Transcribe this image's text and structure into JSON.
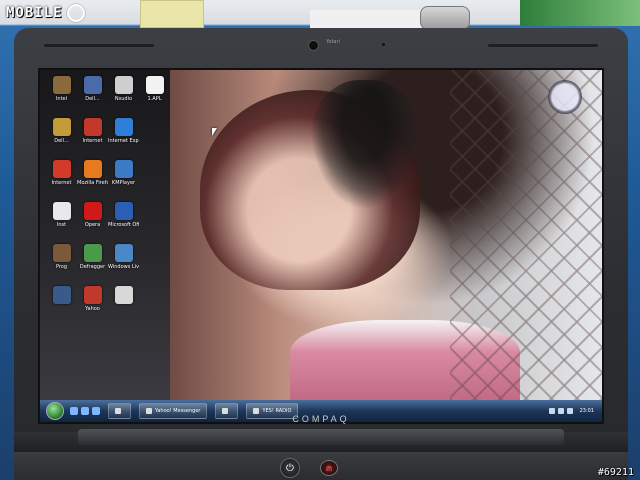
{
  "logo": {
    "text": "MOBILE"
  },
  "watermark": "#69211",
  "laptop": {
    "brand": "COMPAQ",
    "webcam_brand": "Yotari"
  },
  "desktop": {
    "icons": [
      {
        "label": "Intel",
        "icon": "folder-icon",
        "color": "#8a6a3a"
      },
      {
        "label": "Dell...",
        "icon": "app-icon",
        "color": "#4a6aaa"
      },
      {
        "label": "Nsudio",
        "icon": "folder-icon",
        "color": "#cfcfcf"
      },
      {
        "label": "1.APL",
        "icon": "file-icon",
        "color": "#f2f2f2"
      },
      {
        "label": "Dell...",
        "icon": "folder-icon",
        "color": "#c49a3a"
      },
      {
        "label": "Internet",
        "icon": "app-icon",
        "color": "#c0392b"
      },
      {
        "label": "Internet Explorer",
        "icon": "ie-icon",
        "color": "#2f7fd8"
      },
      {
        "label": "",
        "icon": "",
        "color": ""
      },
      {
        "label": "Internet",
        "icon": "app-icon",
        "color": "#d23a2a"
      },
      {
        "label": "Mozilla Firefox",
        "icon": "firefox-icon",
        "color": "#e57a1f"
      },
      {
        "label": "KMPlayer",
        "icon": "player-icon",
        "color": "#3a7ac7"
      },
      {
        "label": "",
        "icon": "",
        "color": ""
      },
      {
        "label": "Inst",
        "icon": "file-icon",
        "color": "#e8e8e8"
      },
      {
        "label": "Opera",
        "icon": "opera-icon",
        "color": "#d01a1a"
      },
      {
        "label": "Microsoft Office Word",
        "icon": "word-icon",
        "color": "#2b5fb4"
      },
      {
        "label": "",
        "icon": "",
        "color": ""
      },
      {
        "label": "Prog",
        "icon": "app-icon",
        "color": "#7a5a3a"
      },
      {
        "label": "Defragger",
        "icon": "defrag-icon",
        "color": "#4a9a4a"
      },
      {
        "label": "Windows Live",
        "icon": "app-icon",
        "color": "#4a88c8"
      },
      {
        "label": "",
        "icon": "",
        "color": ""
      },
      {
        "label": "",
        "icon": "app-icon",
        "color": "#3a5a8a"
      },
      {
        "label": "Yahoo",
        "icon": "browser-icon",
        "color": "#c0392b"
      },
      {
        "label": "",
        "icon": "file-icon",
        "color": "#d8d8d8"
      },
      {
        "label": "",
        "icon": "",
        "color": ""
      }
    ]
  },
  "taskbar": {
    "buttons": [
      {
        "label": "",
        "icon": "folder-icon"
      },
      {
        "label": "Yahoo! Messenger",
        "icon": "messenger-icon"
      },
      {
        "label": "",
        "icon": "explorer-icon"
      },
      {
        "label": "YES! RADIO",
        "icon": "radio-icon"
      }
    ],
    "time": "23:01"
  }
}
